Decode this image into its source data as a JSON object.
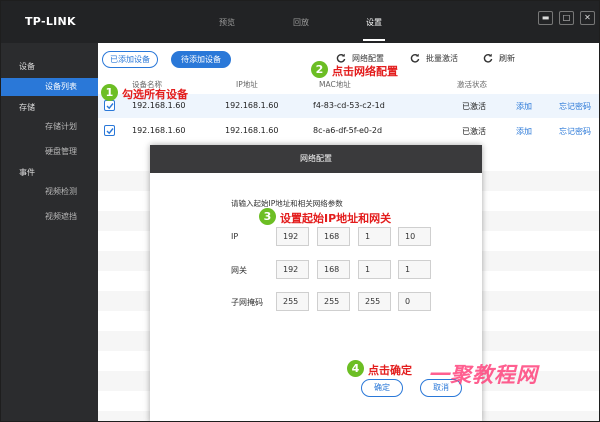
{
  "app": {
    "logo": "TP-LINK"
  },
  "nav": {
    "tabs": [
      "预览",
      "回放",
      "设置"
    ]
  },
  "window_controls": {
    "minimize": "▬",
    "maximize": "□",
    "close": "✕"
  },
  "sidebar": {
    "groups": [
      "设备",
      "存储",
      "事件"
    ],
    "items": [
      "设备列表",
      "存储计划",
      "硬盘管理",
      "视频检测",
      "视频遮挡"
    ]
  },
  "toolbar": {
    "added_label": "已添加设备",
    "pending_label": "待添加设备",
    "netconfig_label": "网络配置",
    "batch_label": "批量激活",
    "refresh_label": "刷新"
  },
  "table": {
    "headers": [
      "设备名称",
      "IP地址",
      "MAC地址",
      "激活状态"
    ],
    "rows": [
      {
        "name": "192.168.1.60",
        "ip": "192.168.1.60",
        "mac": "f4-83-cd-53-c2-1d",
        "status": "已激活",
        "add": "添加",
        "forgot": "忘记密码"
      },
      {
        "name": "192.168.1.60",
        "ip": "192.168.1.60",
        "mac": "8c-a6-df-5f-e0-2d",
        "status": "已激活",
        "add": "添加",
        "forgot": "忘记密码"
      }
    ]
  },
  "annotations": [
    {
      "num": "1",
      "text": "勾选所有设备"
    },
    {
      "num": "2",
      "text": "点击网络配置"
    },
    {
      "num": "3",
      "text": "设置起始IP地址和网关"
    },
    {
      "num": "4",
      "text": "点击确定"
    }
  ],
  "dialog": {
    "title": "网络配置",
    "hint": "请输入起始IP地址和相关网络参数",
    "ip_label": "IP",
    "ip": [
      "192",
      "168",
      "1",
      "10"
    ],
    "gateway_label": "网关",
    "gateway": [
      "192",
      "168",
      "1",
      "1"
    ],
    "mask_label": "子网掩码",
    "mask": [
      "255",
      "255",
      "255",
      "0"
    ],
    "ok_label": "确定",
    "cancel_label": "取消"
  },
  "watermark": {
    "text": "一聚教程网"
  },
  "colors": {
    "accent": "#2a78d8",
    "annotation_red": "#e31d1d",
    "badge_green": "#6cbe24",
    "sidebar_bg": "#2b2c2e"
  }
}
